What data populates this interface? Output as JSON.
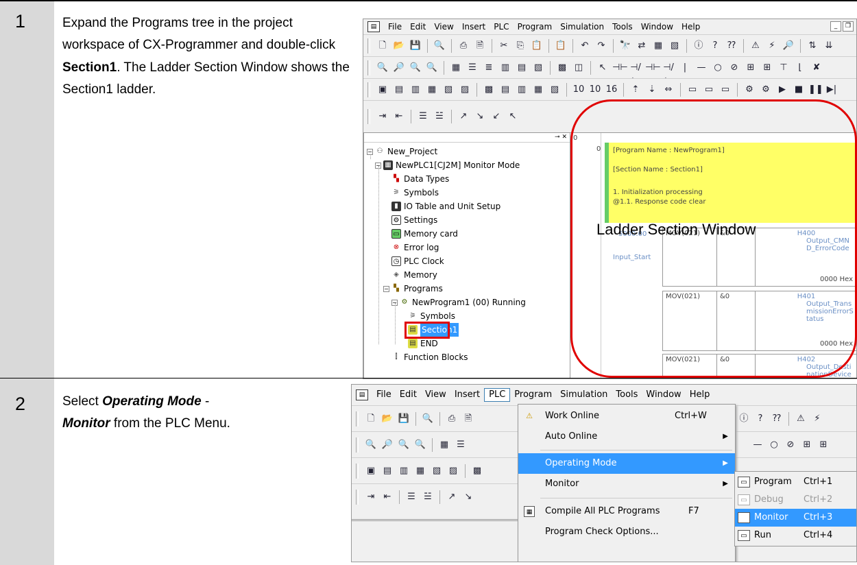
{
  "steps": [
    {
      "number": "1",
      "instruction_a": "Expand the Programs tree in the project workspace of CX-Programmer and double-click ",
      "instruction_bold": "Section1",
      "instruction_b": ". The Ladder Section Window shows the Section1 ladder."
    },
    {
      "number": "2",
      "instruction_a": "Select ",
      "instruction_bold1": "Operating Mode",
      "instruction_mid": " - ",
      "instruction_bold2": "Monitor",
      "instruction_b": " from the PLC Menu."
    }
  ],
  "screenshot1": {
    "menu": [
      "File",
      "Edit",
      "View",
      "Insert",
      "PLC",
      "Program",
      "Simulation",
      "Tools",
      "Window",
      "Help"
    ],
    "tree": [
      {
        "label": "New_Project",
        "icon": "project-icon"
      },
      {
        "label": "NewPLC1[CJ2M] Monitor Mode",
        "icon": "plc-icon"
      },
      {
        "label": "Data Types",
        "icon": "datatypes-icon"
      },
      {
        "label": "Symbols",
        "icon": "symbols-icon"
      },
      {
        "label": "IO Table and Unit Setup",
        "icon": "io-table-icon"
      },
      {
        "label": "Settings",
        "icon": "settings-icon"
      },
      {
        "label": "Memory card",
        "icon": "memory-card-icon"
      },
      {
        "label": "Error log",
        "icon": "error-log-icon"
      },
      {
        "label": "PLC Clock",
        "icon": "clock-icon"
      },
      {
        "label": "Memory",
        "icon": "memory-icon"
      },
      {
        "label": "Programs",
        "icon": "programs-icon"
      },
      {
        "label": "NewProgram1 (00) Running",
        "icon": "program-icon"
      },
      {
        "label": "Symbols",
        "icon": "symbols-icon"
      },
      {
        "label": "Section1",
        "icon": "section-icon"
      },
      {
        "label": "END",
        "icon": "section-icon"
      },
      {
        "label": "Function Blocks",
        "icon": "function-blocks-icon"
      }
    ],
    "ladder": {
      "rung_index_top": "0",
      "rung_index": "0",
      "program_name": "[Program Name : NewProgram1]",
      "section_name": "[Section Name : Section1]",
      "comment1": "1. Initialization processing",
      "comment2": "@1.1. Response code clear",
      "value_5000": "5000.00",
      "input_start": "Input_Start",
      "rows": [
        {
          "instr": "MOV(021)",
          "src": "&0",
          "addr": "H400",
          "name": "Output_CMND_ErrorCode",
          "val": "0000 Hex"
        },
        {
          "instr": "MOV(021)",
          "src": "&0",
          "addr": "H401",
          "name": "Output_TransmissionErrorStatus",
          "val": "0000 Hex"
        },
        {
          "instr": "MOV(021)",
          "src": "&0",
          "addr": "H402",
          "name": "Output_DestinationDeviceErrorCode",
          "val": ""
        }
      ],
      "window_label": "Ladder Section Window"
    }
  },
  "screenshot2": {
    "menu": [
      "File",
      "Edit",
      "View",
      "Insert",
      "PLC",
      "Program",
      "Simulation",
      "Tools",
      "Window",
      "Help"
    ],
    "plc_menu": [
      {
        "label": "Work Online",
        "shortcut": "Ctrl+W",
        "icon": "warning-icon"
      },
      {
        "label": "Auto Online",
        "shortcut": "",
        "submenu": true
      },
      {
        "label": "Operating Mode",
        "shortcut": "",
        "submenu": true,
        "highlighted": true
      },
      {
        "label": "Monitor",
        "shortcut": "",
        "submenu": true
      },
      {
        "label": "Compile All PLC Programs",
        "shortcut": "F7",
        "icon": "compile-icon"
      },
      {
        "label": "Program Check Options...",
        "shortcut": ""
      }
    ],
    "submenu": [
      {
        "label": "Program",
        "shortcut": "Ctrl+1"
      },
      {
        "label": "Debug",
        "shortcut": "Ctrl+2",
        "disabled": true
      },
      {
        "label": "Monitor",
        "shortcut": "Ctrl+3",
        "highlighted": true
      },
      {
        "label": "Run",
        "shortcut": "Ctrl+4"
      }
    ]
  }
}
